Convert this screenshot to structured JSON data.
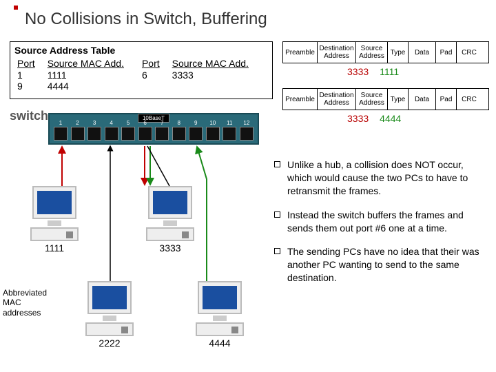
{
  "title": "No Collisions in Switch, Buffering",
  "sat": {
    "heading": "Source Address Table",
    "h_port": "Port",
    "h_mac": "Source MAC Add.",
    "left": {
      "ports": [
        "1",
        "9"
      ],
      "macs": [
        "1111",
        "4444"
      ]
    },
    "right": {
      "ports": [
        "6"
      ],
      "macs": [
        "3333"
      ]
    }
  },
  "frame_fields": [
    "Preamble",
    "Destination\nAddress",
    "Source\nAddress",
    "Type",
    "Data",
    "Pad",
    "CRC"
  ],
  "frame1": {
    "dst": "3333",
    "src": "1111"
  },
  "frame2": {
    "dst": "3333",
    "src": "4444"
  },
  "switch": {
    "label": "switch",
    "banner": "10BaseT",
    "ports": [
      "1",
      "2",
      "3",
      "4",
      "5",
      "6",
      "7",
      "8",
      "9",
      "10",
      "11",
      "12"
    ]
  },
  "pcs": {
    "p1": "1111",
    "p2": "2222",
    "p3": "3333",
    "p4": "4444"
  },
  "abbr": "Abbreviated MAC addresses",
  "bullets": {
    "b1": "Unlike a hub, a collision does NOT occur, which would cause the two PCs to have to retransmit the frames.",
    "b2": "Instead the switch buffers the frames and sends them out port #6 one at a time.",
    "b3": "The sending PCs have no idea that their was another PC wanting to send to the same destination."
  },
  "chart_data": {
    "type": "table",
    "title": "Source Address Table",
    "columns": [
      "Port",
      "Source MAC Add."
    ],
    "rows": [
      {
        "Port": 1,
        "Source MAC Add.": "1111"
      },
      {
        "Port": 9,
        "Source MAC Add.": "4444"
      },
      {
        "Port": 6,
        "Source MAC Add.": "3333"
      }
    ]
  }
}
